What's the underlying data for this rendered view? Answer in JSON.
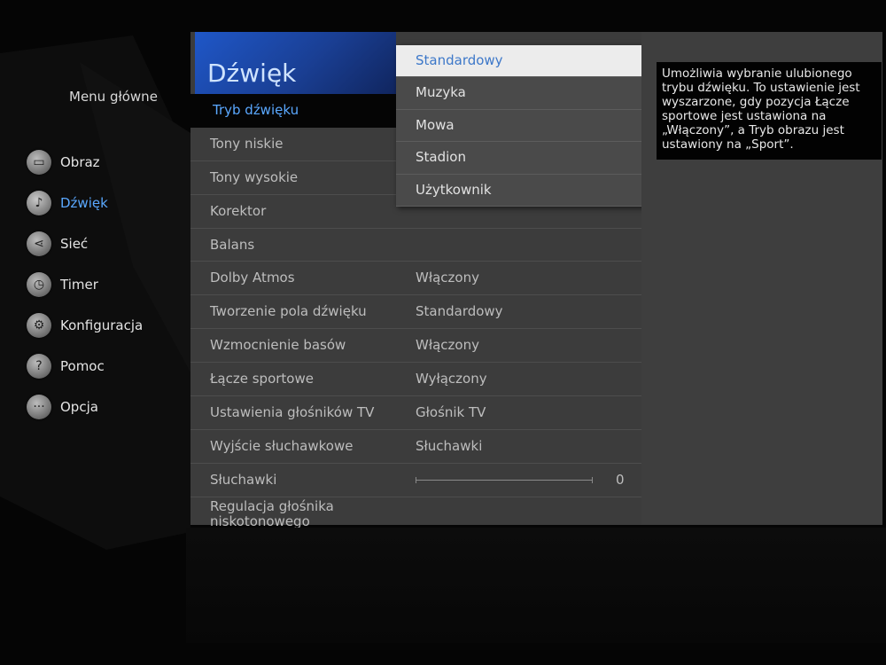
{
  "sidebar": {
    "title": "Menu główne",
    "items": [
      {
        "label": "Obraz",
        "icon": "tv-icon"
      },
      {
        "label": "Dźwięk",
        "icon": "music-note-icon",
        "active": true
      },
      {
        "label": "Sieć",
        "icon": "share-icon"
      },
      {
        "label": "Timer",
        "icon": "clock-icon"
      },
      {
        "label": "Konfiguracja",
        "icon": "wrench-icon"
      },
      {
        "label": "Pomoc",
        "icon": "question-icon"
      },
      {
        "label": "Opcja",
        "icon": "dots-icon"
      }
    ]
  },
  "panel": {
    "title": "Dźwięk",
    "rows": [
      {
        "label": "Tryb dźwięku",
        "value": ""
      },
      {
        "label": "Tony niskie",
        "value": ""
      },
      {
        "label": "Tony wysokie",
        "value": ""
      },
      {
        "label": "Korektor",
        "value": ""
      },
      {
        "label": "Balans",
        "value": ""
      },
      {
        "label": "Dolby Atmos",
        "value": "Włączony"
      },
      {
        "label": "Tworzenie pola dźwięku",
        "value": "Standardowy"
      },
      {
        "label": "Wzmocnienie basów",
        "value": "Włączony"
      },
      {
        "label": "Łącze sportowe",
        "value": "Wyłączony"
      },
      {
        "label": "Ustawienia głośników TV",
        "value": "Głośnik TV"
      },
      {
        "label": "Wyjście słuchawkowe",
        "value": "Słuchawki"
      },
      {
        "label": "Słuchawki",
        "value": "0"
      },
      {
        "label": "Regulacja głośnika niskotonowego",
        "value": ""
      }
    ]
  },
  "dropdown": {
    "options": [
      "Standardowy",
      "Muzyka",
      "Mowa",
      "Stadion",
      "Użytkownik"
    ],
    "selected": "Standardowy"
  },
  "info": {
    "text": "Umożliwia wybranie ulubionego trybu dźwięku. To ustawienie jest wyszarzone, gdy pozycja Łącze sportowe jest ustawiona na „Włączony”, a Tryb obrazu jest ustawiony na „Sport”."
  },
  "colors": {
    "accent": "#5aa8ff",
    "header": "#1f57c8",
    "panel": "#3c3c3c"
  }
}
